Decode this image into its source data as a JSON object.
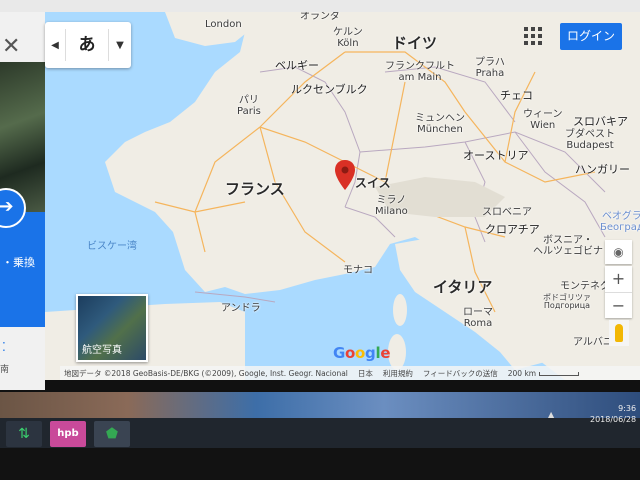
{
  "toolbar": {
    "close_symbol": "✕",
    "lang_prev": "◀",
    "lang_char": "あ",
    "lang_dropdown": "▼",
    "login_label": "ログイン"
  },
  "left_panel": {
    "route_symbol": "➔",
    "route_label": "・乗換",
    "dots_symbol": "⁚",
    "partial_text": "南"
  },
  "map": {
    "countries": {
      "germany": "ドイツ",
      "france": "フランス",
      "switzerland": "スイス",
      "italy": "イタリア",
      "belgium": "ベルギー",
      "luxembourg": "ルクセンブルク",
      "czech": "チェコ",
      "austria": "オーストリア",
      "slovakia": "スロバキア",
      "hungary": "ハンガリー",
      "slovenia": "スロベニア",
      "croatia": "クロアチア",
      "bosnia": "ボスニア・\nヘルツェゴビナ",
      "montenegro": "モンテネグロ",
      "monaco": "モナコ",
      "andorra": "アンドラ",
      "netherlands": "オランダ",
      "albania": "アルバニア"
    },
    "cities": {
      "london": "London",
      "koln": "ケルン\nKöln",
      "paris": "パリ\nParis",
      "frankfurt": "フランクフルト\nam Main",
      "praha": "プラハ\nPraha",
      "munchen": "ミュンヘン\nMünchen",
      "wien": "ウィーン\nWien",
      "milano": "ミラノ\nMilano",
      "budapest": "ブダペスト\nBudapest",
      "roma": "ローマ\nRoma",
      "beograd": "ベオグラ\nБеоград",
      "podgorica": "ポドゴリツァ\nПодгорица"
    },
    "sea": {
      "biscay": "ビスケー湾"
    },
    "satellite_label": "航空写真",
    "locate_symbol": "◉",
    "zoom_in": "+",
    "zoom_out": "−",
    "google_logo": "Google",
    "attribution": "地図データ ©2018 GeoBasis-DE/BKG (©2009), Google, Inst. Geogr. Nacional",
    "japan": "日本",
    "terms": "利用規約",
    "feedback": "フィードバックの送信",
    "scale": "200 km"
  },
  "taskbar": {
    "arrows_symbol": "⇅",
    "hpb_label": "hpb",
    "maps_symbol": "⬟",
    "tray_arrow": "▲",
    "time": "9:36",
    "date": "2018/06/28"
  },
  "colors": {
    "accent": "#1a73e8",
    "marker": "#d93025",
    "water": "#aadaff",
    "land": "#f0ede5"
  }
}
